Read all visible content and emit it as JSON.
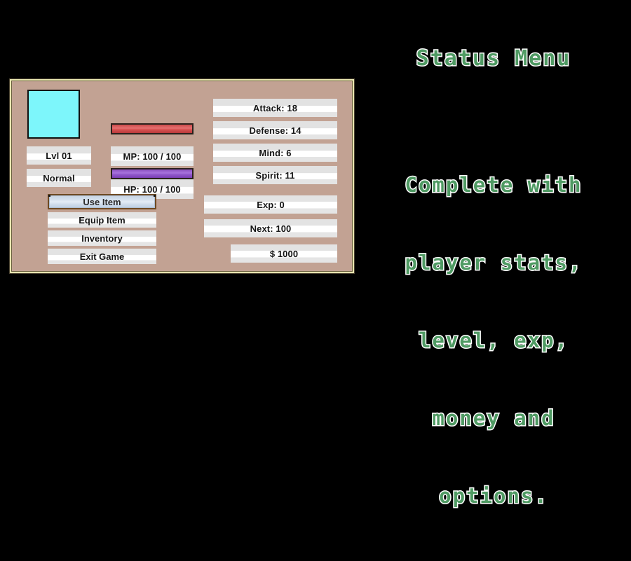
{
  "window": {
    "background_color": "#c2a293",
    "border_color": "#e8e5b0"
  },
  "character": {
    "avatar_color": "#7df6fb",
    "level_label": "Lvl 01",
    "condition_label": "Normal"
  },
  "gauges": {
    "hp_label": "HP: 100 / 100",
    "hp_color": "#d85252",
    "hp_percent": 100,
    "mp_label": "MP: 100 / 100",
    "mp_color": "#9158cc",
    "mp_percent": 100
  },
  "commands": [
    {
      "label": "Use Item",
      "selected": true
    },
    {
      "label": "Equip Item",
      "selected": false
    },
    {
      "label": "Inventory",
      "selected": false
    },
    {
      "label": "Exit Game",
      "selected": false
    }
  ],
  "stats": [
    {
      "label": "Attack: 18"
    },
    {
      "label": "Defense: 14"
    },
    {
      "label": "Mind: 6"
    },
    {
      "label": "Spirit: 11"
    }
  ],
  "progress": {
    "exp_label": "Exp: 0",
    "next_label": "Next: 100",
    "money_label": "$ 1000"
  },
  "caption": {
    "title": "Status Menu",
    "accent_color": "#4f9a63",
    "outline_color": "#ffffff",
    "body_lines": [
      "Complete with",
      "player stats,",
      "level, exp,",
      "money and",
      "options."
    ]
  }
}
